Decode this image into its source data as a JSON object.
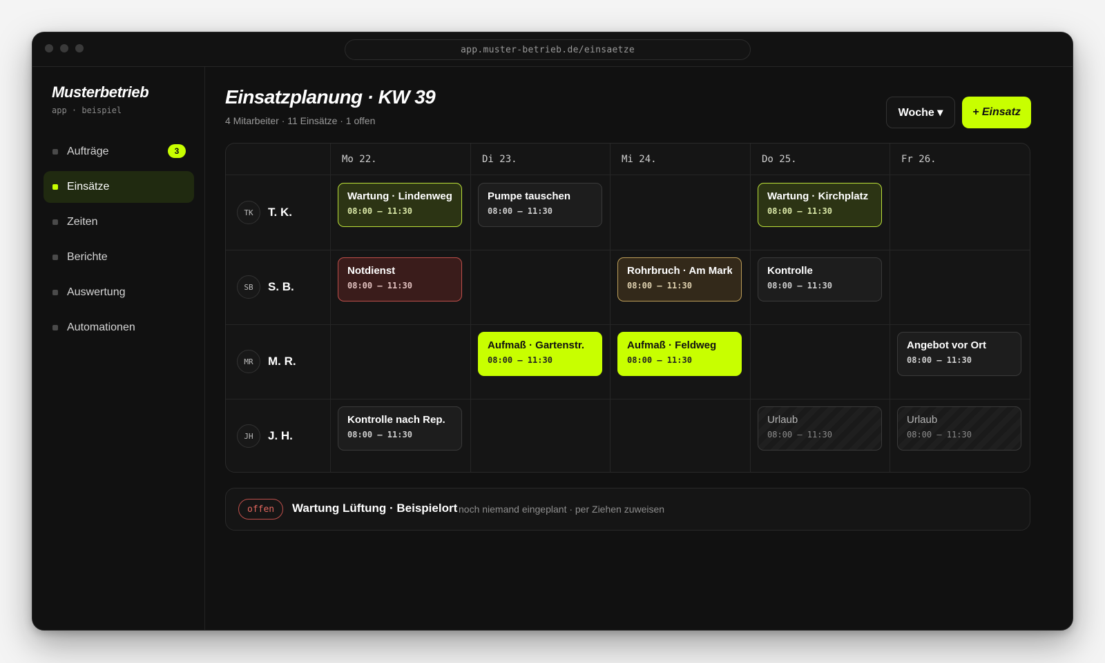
{
  "browser": {
    "url": "app.muster-betrieb.de/einsaetze"
  },
  "brand": {
    "title": "Musterbetrieb",
    "subtitle": "app · beispiel"
  },
  "sidebar": {
    "items": [
      {
        "label": "Aufträge",
        "badge": "3"
      },
      {
        "label": "Einsätze"
      },
      {
        "label": "Zeiten"
      },
      {
        "label": "Berichte"
      },
      {
        "label": "Auswertung"
      },
      {
        "label": "Automationen"
      }
    ]
  },
  "header": {
    "title": "Einsatzplanung · KW 39",
    "subtitle": "4 Mitarbeiter · 11 Einsätze · 1 offen",
    "view_button": "Woche ▾",
    "add_button": "+ Einsatz"
  },
  "schedule": {
    "days": [
      "Mo 22.",
      "Di 23.",
      "Mi 24.",
      "Do 25.",
      "Fr 26."
    ],
    "people": [
      {
        "initials": "TK",
        "name": "T. K."
      },
      {
        "initials": "SB",
        "name": "S. B."
      },
      {
        "initials": "MR",
        "name": "M. R."
      },
      {
        "initials": "JH",
        "name": "J. H."
      }
    ],
    "assignments": [
      {
        "title": "Wartung · Lindenweg",
        "time": "08:00 – 11:30",
        "style": "olive"
      },
      {
        "title": "Pumpe tauschen",
        "time": "08:00 – 11:30",
        "style": "neutral"
      },
      {
        "title": "Wartung · Kirchplatz",
        "time": "08:00 – 11:30",
        "style": "olive"
      },
      {
        "title": "Notdienst",
        "time": "08:00 – 11:30",
        "style": "red"
      },
      {
        "title": "Rohrbruch · Am Markt",
        "time": "08:00 – 11:30",
        "style": "amber"
      },
      {
        "title": "Kontrolle",
        "time": "08:00 – 11:30",
        "style": "neutral"
      },
      {
        "title": "Aufmaß · Gartenstr.",
        "time": "08:00 – 11:30",
        "style": "lime"
      },
      {
        "title": "Aufmaß · Feldweg",
        "time": "08:00 – 11:30",
        "style": "lime"
      },
      {
        "title": "Angebot vor Ort",
        "time": "08:00 – 11:30",
        "style": "neutral"
      },
      {
        "title": "Kontrolle nach Rep.",
        "time": "08:00 – 11:30",
        "style": "neutral"
      },
      {
        "title": "Urlaub",
        "time": "08:00 – 11:30",
        "style": "vacation"
      },
      {
        "title": "Urlaub",
        "time": "08:00 – 11:30",
        "style": "vacation"
      }
    ]
  },
  "open_item": {
    "status": "offen",
    "title": "Wartung Lüftung · Beispielort",
    "note": "noch niemand eingeplant · per Ziehen zuweisen"
  },
  "colors": {
    "accent": "#c8ff00",
    "background": "#111111",
    "danger": "#c0504b",
    "warning": "#bfa05a"
  }
}
